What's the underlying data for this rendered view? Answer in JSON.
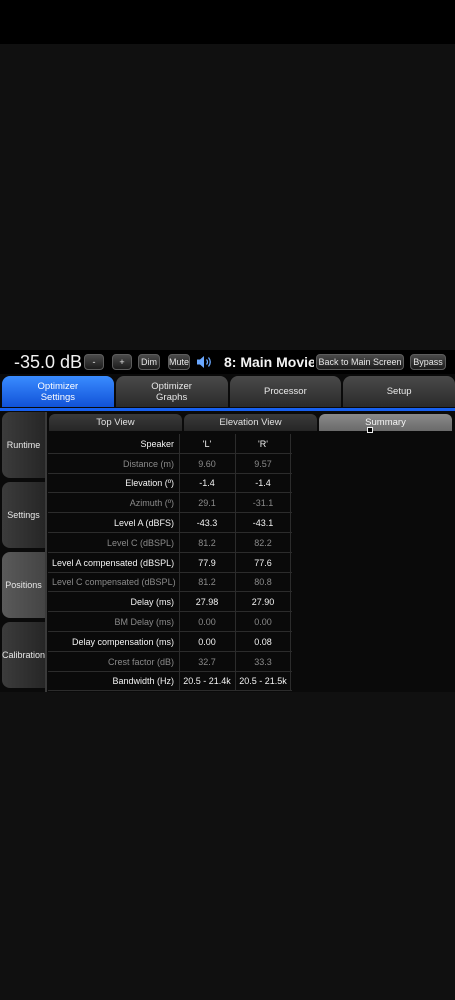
{
  "topbar": {
    "volume": "-35.0 dB",
    "minus_label": "-",
    "plus_label": "+",
    "dim_label": "Dim",
    "mute_label": "Mute",
    "speaker_icon": "speaker-icon",
    "preset": "8: Main Movie",
    "back_label": "Back to Main Screen",
    "bypass_label": "Bypass"
  },
  "main_tabs": [
    {
      "label": "Optimizer\nSettings"
    },
    {
      "label": "Optimizer\nGraphs"
    },
    {
      "label": "Processor"
    },
    {
      "label": "Setup"
    }
  ],
  "side_tabs": [
    {
      "label": "Runtime"
    },
    {
      "label": "Settings"
    },
    {
      "label": "Positions"
    },
    {
      "label": "Calibration"
    }
  ],
  "sub_tabs": [
    {
      "label": "Top View"
    },
    {
      "label": "Elevation View"
    },
    {
      "label": "Summary"
    }
  ],
  "table": {
    "header": {
      "label": "Speaker",
      "left": "'L'",
      "right": "'R'"
    },
    "rows": [
      {
        "label": "Distance (m)",
        "left": "9.60",
        "right": "9.57"
      },
      {
        "label": "Elevation (º)",
        "left": "-1.4",
        "right": "-1.4"
      },
      {
        "label": "Azimuth (º)",
        "left": "29.1",
        "right": "-31.1"
      },
      {
        "label": "Level A (dBFS)",
        "left": "-43.3",
        "right": "-43.1"
      },
      {
        "label": "Level C (dBSPL)",
        "left": "81.2",
        "right": "82.2"
      },
      {
        "label": "Level A compensated (dBSPL)",
        "left": "77.9",
        "right": "77.6"
      },
      {
        "label": "Level C compensated (dBSPL)",
        "left": "81.2",
        "right": "80.8"
      },
      {
        "label": "Delay (ms)",
        "left": "27.98",
        "right": "27.90"
      },
      {
        "label": "BM Delay (ms)",
        "left": "0.00",
        "right": "0.00"
      },
      {
        "label": "Delay compensation (ms)",
        "left": "0.00",
        "right": "0.08"
      },
      {
        "label": "Crest factor (dB)",
        "left": "32.7",
        "right": "33.3"
      },
      {
        "label": "Bandwidth (Hz)",
        "left": "20.5 - 21.4k",
        "right": "20.5 - 21.5k"
      }
    ]
  }
}
